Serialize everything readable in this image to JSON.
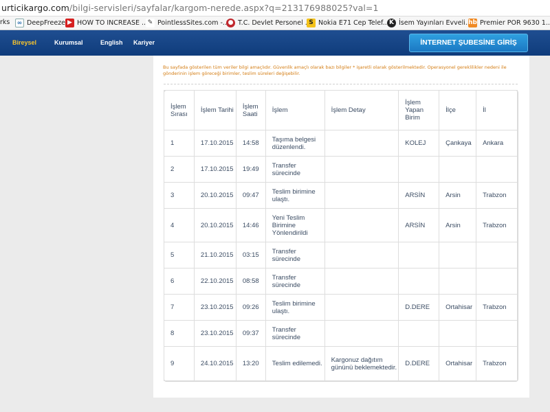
{
  "browser": {
    "url_host": "urticikargo.com",
    "url_path": "/bilgi-servisleri/sayfalar/kargom-nerede.aspx?q=213176988025?val=1",
    "bookmarks": [
      {
        "label": "rks",
        "icon": "none"
      },
      {
        "label": "DeepFreeze",
        "icon": "link-icon"
      },
      {
        "label": "HOW TO INCREASE ...",
        "icon": "youtube-icon"
      },
      {
        "label": "PointlessSites.com -...",
        "icon": "pen-icon"
      },
      {
        "label": "T.C. Devlet Personel ...",
        "icon": "circle-icon"
      },
      {
        "label": "Nokia E71 Cep Telef...",
        "icon": "s-icon"
      },
      {
        "label": "İsem Yayınları Evveli...",
        "icon": "k-icon"
      },
      {
        "label": "Premier POR 9630 1...",
        "icon": "hb-icon"
      }
    ]
  },
  "nav": {
    "items": [
      "Bireysel",
      "Kurumsal",
      "English",
      "Kariyer"
    ],
    "login_label": "İNTERNET ŞUBESİNE GİRİŞ"
  },
  "notice": "Bu sayfada gösterilen tüm veriler bilgi amaçlıdır. Güvenlik amaçlı olarak bazı bilgiler * işaretli olarak gösterilmektedir. Operasyonel gereklilikler nedeni ile gönderinin işlem göreceği birimler, teslim süreleri değişebilir.",
  "table": {
    "headers": [
      "İşlem Sırası",
      "İşlem Tarihi",
      "İşlem Saati",
      "İşlem",
      "İşlem Detay",
      "İşlem Yapan Birim",
      "İlçe",
      "İl"
    ],
    "rows": [
      [
        "1",
        "17.10.2015",
        "14:58",
        "Taşıma belgesi düzenlendi.",
        "",
        "KOLEJ",
        "Çankaya",
        "Ankara"
      ],
      [
        "2",
        "17.10.2015",
        "19:49",
        "Transfer sürecinde",
        "",
        "",
        "",
        ""
      ],
      [
        "3",
        "20.10.2015",
        "09:47",
        "Teslim birimine ulaştı.",
        "",
        "ARSİN",
        "Arsin",
        "Trabzon"
      ],
      [
        "4",
        "20.10.2015",
        "14:46",
        "Yeni Teslim Birimine Yönlendirildi",
        "",
        "ARSİN",
        "Arsin",
        "Trabzon"
      ],
      [
        "5",
        "21.10.2015",
        "03:15",
        "Transfer sürecinde",
        "",
        "",
        "",
        ""
      ],
      [
        "6",
        "22.10.2015",
        "08:58",
        "Transfer sürecinde",
        "",
        "",
        "",
        ""
      ],
      [
        "7",
        "23.10.2015",
        "09:26",
        "Teslim birimine ulaştı.",
        "",
        "D.DERE",
        "Ortahisar",
        "Trabzon"
      ],
      [
        "8",
        "23.10.2015",
        "09:37",
        "Transfer sürecinde",
        "",
        "",
        "",
        ""
      ],
      [
        "9",
        "24.10.2015",
        "13:20",
        "Teslim edilemedi.",
        "Kargonuz dağıtım gününü beklemektedir.",
        "D.DERE",
        "Ortahisar",
        "Trabzon"
      ]
    ]
  },
  "colors": {
    "nav_bg": "#1f4e91",
    "nav_active": "#f7c42d",
    "login_bg": "#1b78c3",
    "notice_text": "#d37b10",
    "cell_text": "#3a4b62"
  }
}
